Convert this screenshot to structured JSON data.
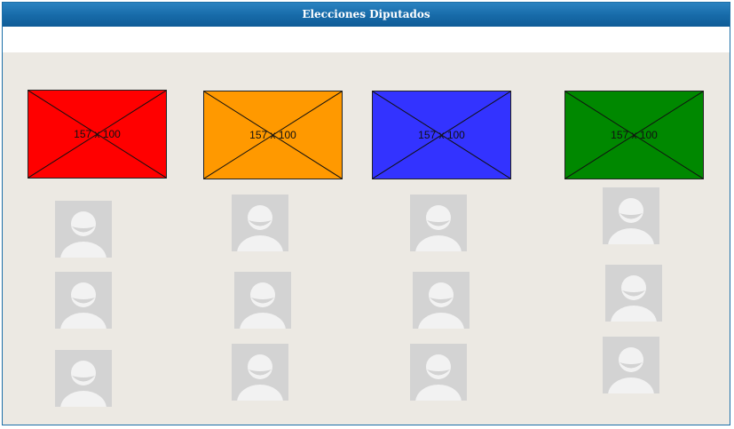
{
  "window": {
    "title": "Elecciones Diputados"
  },
  "parties": [
    {
      "placeholder": "157 x 100",
      "color": "#ff0000",
      "candidates": 3
    },
    {
      "placeholder": "157 x 100",
      "color": "#ff9900",
      "candidates": 3
    },
    {
      "placeholder": "157 x 100",
      "color": "#3333ff",
      "candidates": 3
    },
    {
      "placeholder": "157 x 100",
      "color": "#008800",
      "candidates": 3
    }
  ],
  "icons": {
    "candidate": "user-avatar-icon"
  }
}
